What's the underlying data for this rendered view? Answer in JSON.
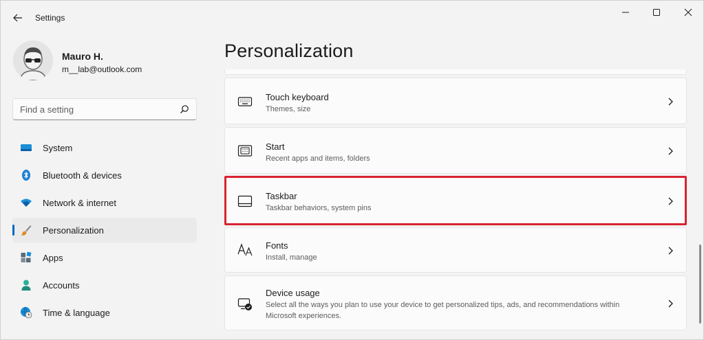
{
  "window": {
    "title": "Settings",
    "controls": [
      "minimize",
      "maximize",
      "close"
    ]
  },
  "profile": {
    "name": "Mauro H.",
    "email": "m__lab@outlook.com"
  },
  "search": {
    "placeholder": "Find a setting"
  },
  "sidebar": {
    "items": [
      {
        "label": "System",
        "icon": "monitor-icon"
      },
      {
        "label": "Bluetooth & devices",
        "icon": "bluetooth-icon"
      },
      {
        "label": "Network & internet",
        "icon": "wifi-icon"
      },
      {
        "label": "Personalization",
        "icon": "brush-icon",
        "active": true
      },
      {
        "label": "Apps",
        "icon": "apps-icon"
      },
      {
        "label": "Accounts",
        "icon": "person-icon"
      },
      {
        "label": "Time & language",
        "icon": "globe-clock-icon"
      }
    ]
  },
  "main": {
    "title": "Personalization",
    "cards": [
      {
        "title": "Touch keyboard",
        "subtitle": "Themes, size",
        "icon": "keyboard-icon"
      },
      {
        "title": "Start",
        "subtitle": "Recent apps and items, folders",
        "icon": "start-icon"
      },
      {
        "title": "Taskbar",
        "subtitle": "Taskbar behaviors, system pins",
        "icon": "taskbar-icon",
        "highlighted": true
      },
      {
        "title": "Fonts",
        "subtitle": "Install, manage",
        "icon": "fonts-icon"
      },
      {
        "title": "Device usage",
        "subtitle": "Select all the ways you plan to use your device to get personalized tips, ads, and recommendations within Microsoft experiences.",
        "icon": "device-usage-icon"
      }
    ]
  },
  "colors": {
    "accent": "#0067c0",
    "highlight_border": "#d8232e",
    "window_bg": "#f3f3f3",
    "card_bg": "#fbfbfb"
  }
}
